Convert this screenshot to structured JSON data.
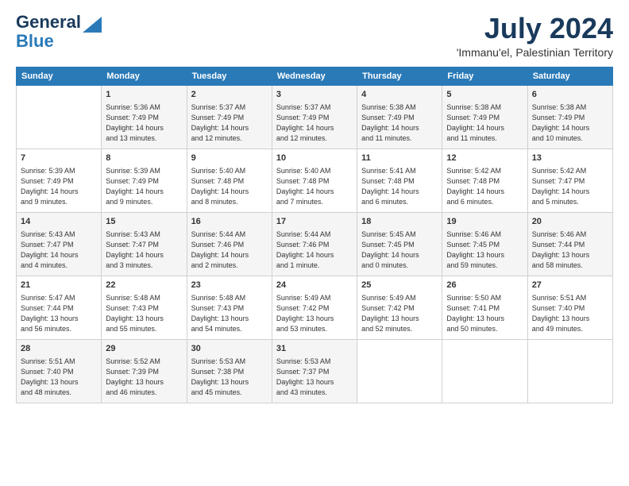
{
  "header": {
    "logo_line1": "General",
    "logo_line2": "Blue",
    "month_year": "July 2024",
    "location": "'Immanu'el, Palestinian Territory"
  },
  "columns": [
    "Sunday",
    "Monday",
    "Tuesday",
    "Wednesday",
    "Thursday",
    "Friday",
    "Saturday"
  ],
  "weeks": [
    [
      {
        "day": "",
        "content": ""
      },
      {
        "day": "1",
        "content": "Sunrise: 5:36 AM\nSunset: 7:49 PM\nDaylight: 14 hours\nand 13 minutes."
      },
      {
        "day": "2",
        "content": "Sunrise: 5:37 AM\nSunset: 7:49 PM\nDaylight: 14 hours\nand 12 minutes."
      },
      {
        "day": "3",
        "content": "Sunrise: 5:37 AM\nSunset: 7:49 PM\nDaylight: 14 hours\nand 12 minutes."
      },
      {
        "day": "4",
        "content": "Sunrise: 5:38 AM\nSunset: 7:49 PM\nDaylight: 14 hours\nand 11 minutes."
      },
      {
        "day": "5",
        "content": "Sunrise: 5:38 AM\nSunset: 7:49 PM\nDaylight: 14 hours\nand 11 minutes."
      },
      {
        "day": "6",
        "content": "Sunrise: 5:38 AM\nSunset: 7:49 PM\nDaylight: 14 hours\nand 10 minutes."
      }
    ],
    [
      {
        "day": "7",
        "content": "Sunrise: 5:39 AM\nSunset: 7:49 PM\nDaylight: 14 hours\nand 9 minutes."
      },
      {
        "day": "8",
        "content": "Sunrise: 5:39 AM\nSunset: 7:49 PM\nDaylight: 14 hours\nand 9 minutes."
      },
      {
        "day": "9",
        "content": "Sunrise: 5:40 AM\nSunset: 7:48 PM\nDaylight: 14 hours\nand 8 minutes."
      },
      {
        "day": "10",
        "content": "Sunrise: 5:40 AM\nSunset: 7:48 PM\nDaylight: 14 hours\nand 7 minutes."
      },
      {
        "day": "11",
        "content": "Sunrise: 5:41 AM\nSunset: 7:48 PM\nDaylight: 14 hours\nand 6 minutes."
      },
      {
        "day": "12",
        "content": "Sunrise: 5:42 AM\nSunset: 7:48 PM\nDaylight: 14 hours\nand 6 minutes."
      },
      {
        "day": "13",
        "content": "Sunrise: 5:42 AM\nSunset: 7:47 PM\nDaylight: 14 hours\nand 5 minutes."
      }
    ],
    [
      {
        "day": "14",
        "content": "Sunrise: 5:43 AM\nSunset: 7:47 PM\nDaylight: 14 hours\nand 4 minutes."
      },
      {
        "day": "15",
        "content": "Sunrise: 5:43 AM\nSunset: 7:47 PM\nDaylight: 14 hours\nand 3 minutes."
      },
      {
        "day": "16",
        "content": "Sunrise: 5:44 AM\nSunset: 7:46 PM\nDaylight: 14 hours\nand 2 minutes."
      },
      {
        "day": "17",
        "content": "Sunrise: 5:44 AM\nSunset: 7:46 PM\nDaylight: 14 hours\nand 1 minute."
      },
      {
        "day": "18",
        "content": "Sunrise: 5:45 AM\nSunset: 7:45 PM\nDaylight: 14 hours\nand 0 minutes."
      },
      {
        "day": "19",
        "content": "Sunrise: 5:46 AM\nSunset: 7:45 PM\nDaylight: 13 hours\nand 59 minutes."
      },
      {
        "day": "20",
        "content": "Sunrise: 5:46 AM\nSunset: 7:44 PM\nDaylight: 13 hours\nand 58 minutes."
      }
    ],
    [
      {
        "day": "21",
        "content": "Sunrise: 5:47 AM\nSunset: 7:44 PM\nDaylight: 13 hours\nand 56 minutes."
      },
      {
        "day": "22",
        "content": "Sunrise: 5:48 AM\nSunset: 7:43 PM\nDaylight: 13 hours\nand 55 minutes."
      },
      {
        "day": "23",
        "content": "Sunrise: 5:48 AM\nSunset: 7:43 PM\nDaylight: 13 hours\nand 54 minutes."
      },
      {
        "day": "24",
        "content": "Sunrise: 5:49 AM\nSunset: 7:42 PM\nDaylight: 13 hours\nand 53 minutes."
      },
      {
        "day": "25",
        "content": "Sunrise: 5:49 AM\nSunset: 7:42 PM\nDaylight: 13 hours\nand 52 minutes."
      },
      {
        "day": "26",
        "content": "Sunrise: 5:50 AM\nSunset: 7:41 PM\nDaylight: 13 hours\nand 50 minutes."
      },
      {
        "day": "27",
        "content": "Sunrise: 5:51 AM\nSunset: 7:40 PM\nDaylight: 13 hours\nand 49 minutes."
      }
    ],
    [
      {
        "day": "28",
        "content": "Sunrise: 5:51 AM\nSunset: 7:40 PM\nDaylight: 13 hours\nand 48 minutes."
      },
      {
        "day": "29",
        "content": "Sunrise: 5:52 AM\nSunset: 7:39 PM\nDaylight: 13 hours\nand 46 minutes."
      },
      {
        "day": "30",
        "content": "Sunrise: 5:53 AM\nSunset: 7:38 PM\nDaylight: 13 hours\nand 45 minutes."
      },
      {
        "day": "31",
        "content": "Sunrise: 5:53 AM\nSunset: 7:37 PM\nDaylight: 13 hours\nand 43 minutes."
      },
      {
        "day": "",
        "content": ""
      },
      {
        "day": "",
        "content": ""
      },
      {
        "day": "",
        "content": ""
      }
    ]
  ]
}
